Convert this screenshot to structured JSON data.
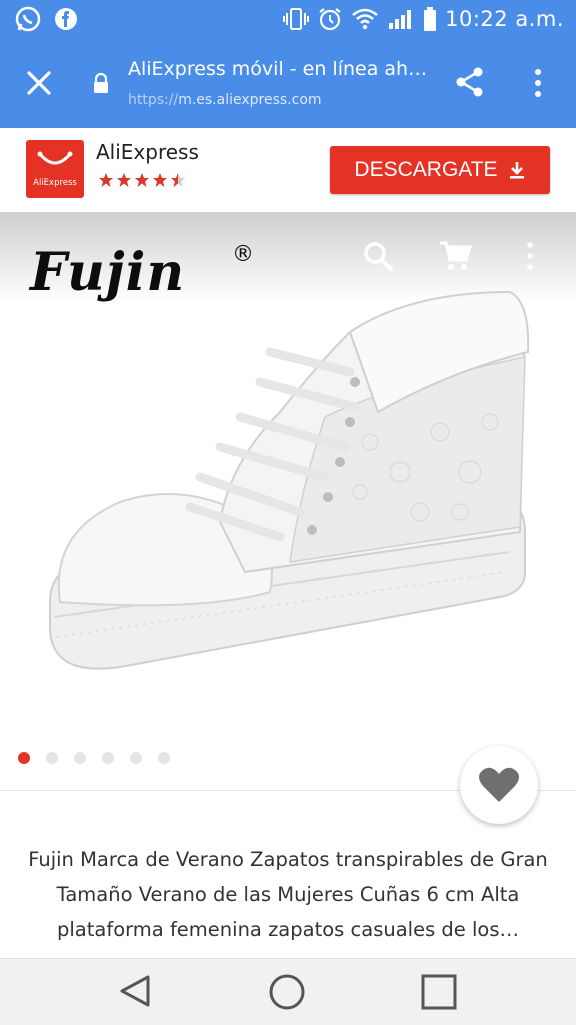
{
  "status_bar": {
    "time": "10:22 a.m.",
    "icons": [
      "whatsapp-icon",
      "facebook-messenger-icon",
      "vibrate-icon",
      "alarm-icon",
      "wifi-icon",
      "signal-icon",
      "battery-icon"
    ]
  },
  "toolbar": {
    "title": "AliExpress móvil - en línea ahora…",
    "url_scheme": "https://",
    "url_host": "m.es.aliexpress.com",
    "icons": [
      "close-icon",
      "lock-icon",
      "share-icon",
      "more-vert-icon"
    ]
  },
  "app_banner": {
    "logo_text": "AliExpress",
    "name": "AliExpress",
    "rating": 4.5,
    "download_label": "DESCARGATE"
  },
  "product": {
    "brand": "Fujin",
    "brand_mark": "®",
    "gallery_count": 6,
    "gallery_active": 0,
    "description": "Fujin Marca de Verano Zapatos transpirables de Gran Tamaño Verano de las Mujeres Cuñas 6 cm Alta plataforma femenina zapatos casuales de los…"
  },
  "colors": {
    "header_blue": "#4a8de8",
    "accent_red": "#e43225",
    "nav_gray": "#f1f1f1"
  }
}
